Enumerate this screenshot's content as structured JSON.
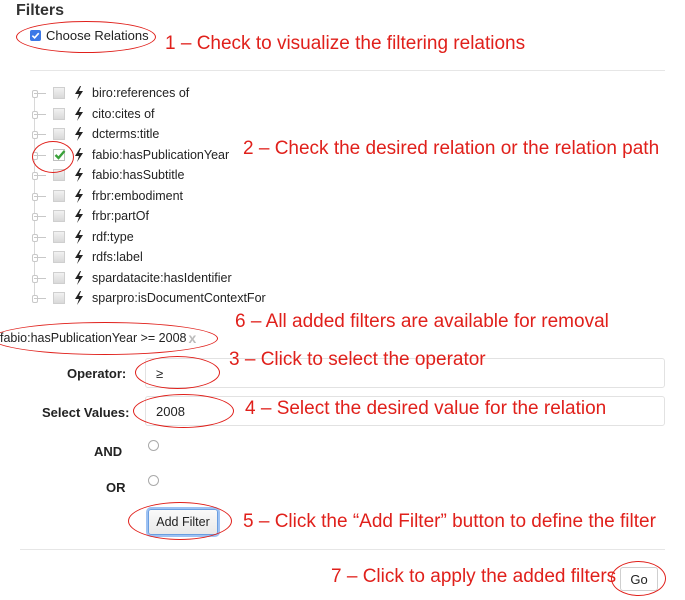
{
  "heading": "Filters",
  "choose_relations": {
    "label": "Choose Relations",
    "checked": true
  },
  "tree": {
    "items": [
      {
        "label": "biro:references of",
        "checked": false
      },
      {
        "label": "cito:cites of",
        "checked": false
      },
      {
        "label": "dcterms:title",
        "checked": false
      },
      {
        "label": "fabio:hasPublicationYear",
        "checked": true
      },
      {
        "label": "fabio:hasSubtitle",
        "checked": false
      },
      {
        "label": "frbr:embodiment",
        "checked": false
      },
      {
        "label": "frbr:partOf",
        "checked": false
      },
      {
        "label": "rdf:type",
        "checked": false
      },
      {
        "label": "rdfs:label",
        "checked": false
      },
      {
        "label": "spardatacite:hasIdentifier",
        "checked": false
      },
      {
        "label": "sparpro:isDocumentContextFor",
        "checked": false
      }
    ]
  },
  "applied_filter": {
    "text": "fabio:hasPublicationYear >= 2008",
    "remove_icon": "x"
  },
  "form": {
    "operator_label": "Operator:",
    "operator_value": "≥",
    "values_label": "Select Values:",
    "values_value": "2008",
    "and_label": "AND",
    "or_label": "OR",
    "add_filter_label": "Add Filter"
  },
  "go_label": "Go",
  "annotations": {
    "a1": "1 – Check to visualize the filtering relations",
    "a2": "2 – Check the desired relation or the relation path",
    "a3": "3 – Click to select the operator",
    "a4": "4 – Select the desired value for the relation",
    "a5": "5 – Click the “Add Filter” button to define the filter",
    "a6": "6 – All added filters are available for removal",
    "a7": "7 – Click to apply the added filters"
  },
  "colors": {
    "annotation": "#e0201b",
    "checkbox_blue": "#3b78e7",
    "checkmark_green": "#3aa13a"
  }
}
